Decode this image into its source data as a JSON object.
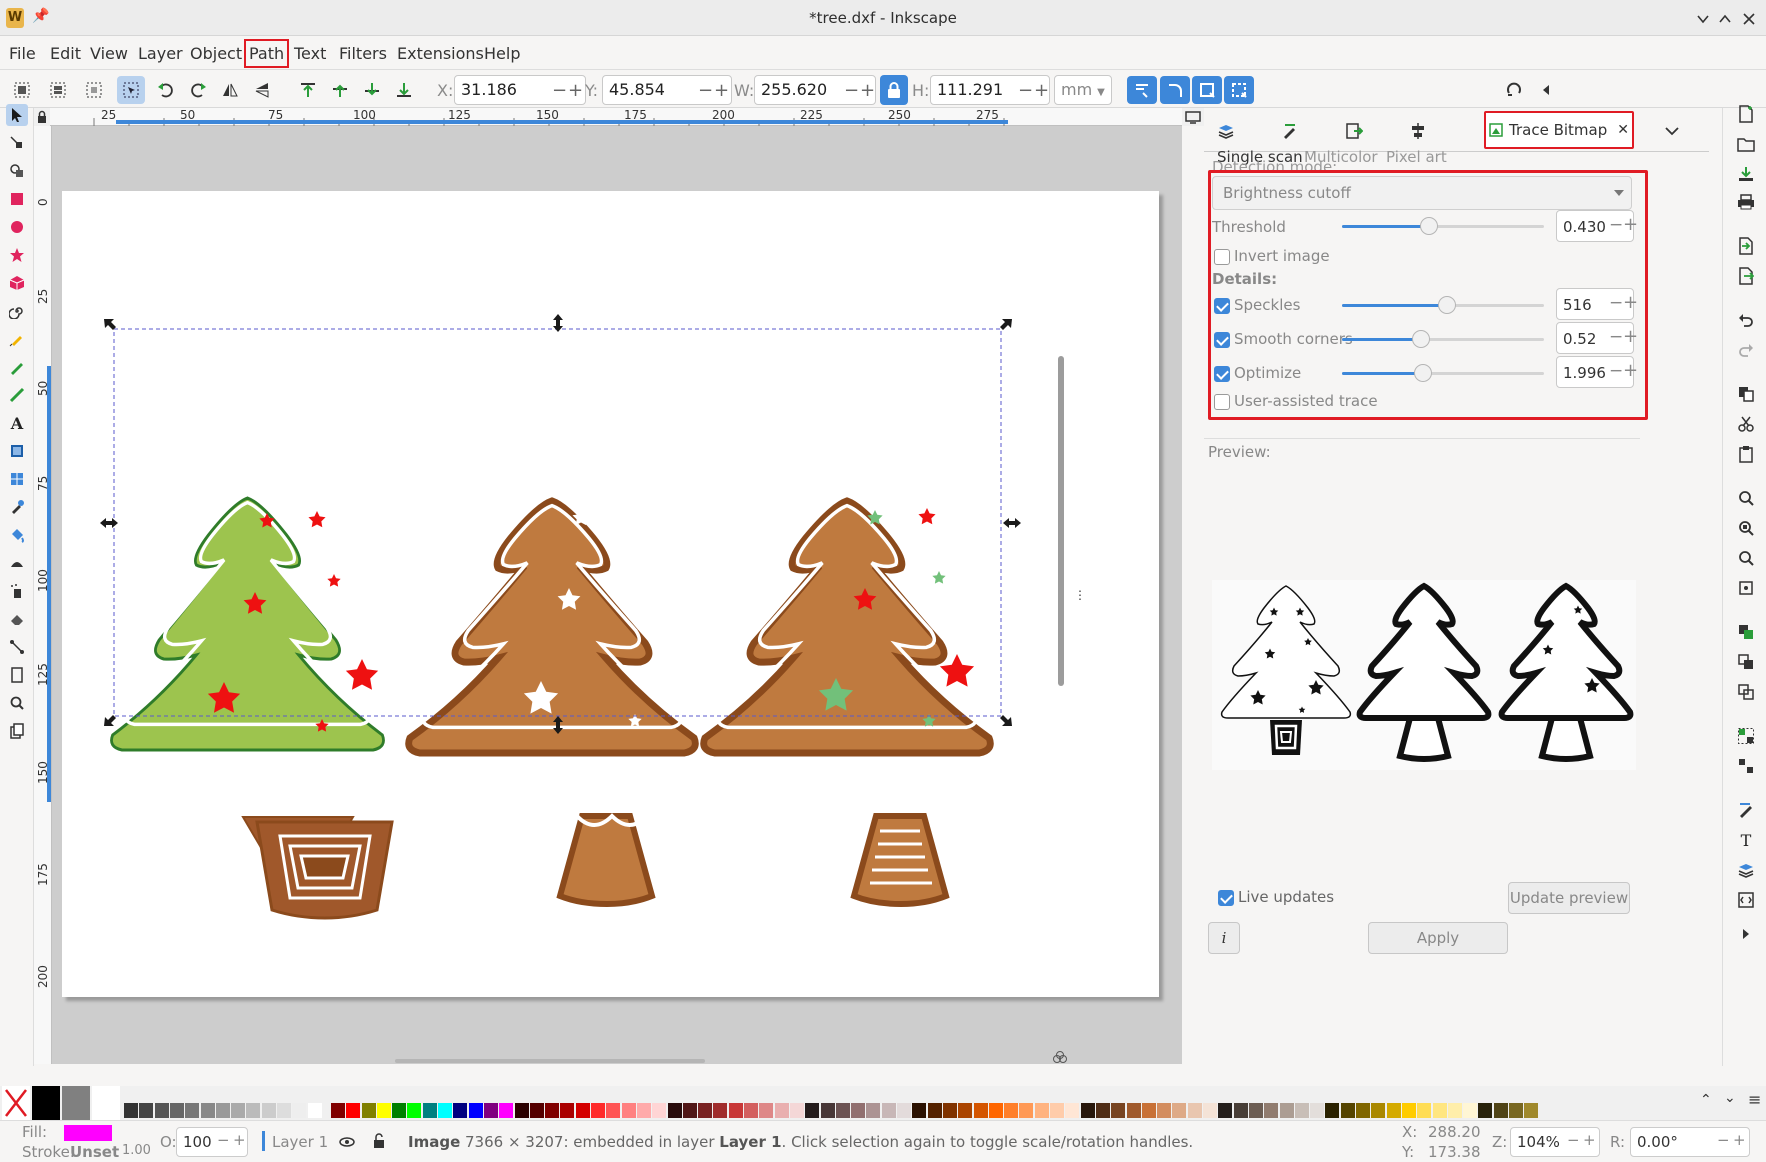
{
  "window": {
    "title": "*tree.dxf - Inkscape"
  },
  "menu": [
    "File",
    "Edit",
    "View",
    "Layer",
    "Object",
    "Path",
    "Text",
    "Filters",
    "Extensions",
    "Help"
  ],
  "menu_highlight": "Path",
  "toolbar": {
    "x_label": "X:",
    "x_value": "31.186",
    "y_label": "Y:",
    "y_value": "45.854",
    "w_label": "W:",
    "w_value": "255.620",
    "h_label": "H:",
    "h_value": "111.291",
    "unit": "mm"
  },
  "ruler": {
    "h_ticks": [
      "25",
      "50",
      "75",
      "100",
      "125",
      "150",
      "175",
      "200",
      "225",
      "250",
      "275"
    ],
    "v_ticks": [
      "0",
      "25",
      "50",
      "75",
      "100",
      "125",
      "150",
      "175",
      "200"
    ]
  },
  "dock": {
    "active_tab": "Trace Bitmap",
    "subtabs": [
      "Single scan",
      "Multicolor",
      "Pixel art"
    ],
    "active_subtab": "Single scan",
    "detection_mode_label": "Detection mode:",
    "detection_mode_value": "Brightness cutoff",
    "threshold_label": "Threshold",
    "threshold_value": "0.430",
    "threshold_fraction": 0.43,
    "invert_label": "Invert image",
    "invert_checked": false,
    "details_label": "Details:",
    "speckles_label": "Speckles",
    "speckles_value": "516",
    "speckles_fraction": 0.52,
    "smooth_label": "Smooth corners",
    "smooth_value": "0.52",
    "smooth_fraction": 0.39,
    "optimize_label": "Optimize",
    "optimize_value": "1.996",
    "optimize_fraction": 0.4,
    "user_assisted_label": "User-assisted trace",
    "preview_label": "Preview:",
    "live_updates_label": "Live updates",
    "update_preview_label": "Update preview",
    "apply_label": "Apply",
    "info_symbol": "i"
  },
  "status": {
    "fill_label": "Fill:",
    "stroke_label": "Stroke:",
    "stroke_value": "Unset",
    "stroke_width": "1.00",
    "opacity_label": "O:",
    "opacity_value": "100",
    "layer_name": "Layer 1",
    "message_bold1": "Image",
    "message_part1": " 7366 × 3207: embedded in layer ",
    "message_bold2": "Layer 1",
    "message_part2": ". Click selection again to toggle scale/rotation handles.",
    "x_label": "X:",
    "x_value": "288.20",
    "y_label": "Y:",
    "y_value": "173.38",
    "zoom_label": "Z:",
    "zoom_value": "104%",
    "rotation_label": "R:",
    "rotation_value": "0.00°"
  },
  "colors": {
    "accent": "#3d87d9",
    "highlight_red": "#e01b24",
    "tree_green": "#9dc44e",
    "gingerbread": "#bf7a3f",
    "gingerbread_dark": "#8b4a1c",
    "star_red": "#ee1111",
    "star_mint": "#72c07a",
    "fill_swatch": "#ff00ff"
  }
}
